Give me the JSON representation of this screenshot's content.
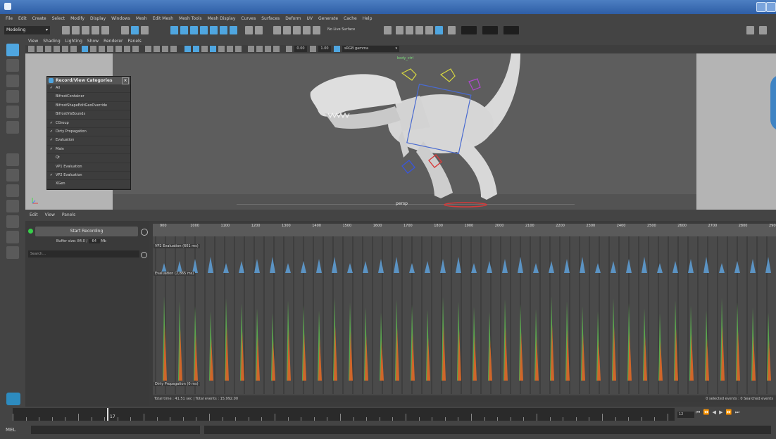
{
  "menus": [
    "File",
    "Edit",
    "Create",
    "Select",
    "Modify",
    "Display",
    "Windows",
    "Mesh",
    "Edit Mesh",
    "Mesh Tools",
    "Mesh Display",
    "Curves",
    "Surfaces",
    "Deform",
    "UV",
    "Generate",
    "Cache",
    "Help"
  ],
  "workspace_mode": "Modeling",
  "shelf": {
    "live_surface_label": "No Live Surface",
    "exposure_value": "0.00",
    "gamma_value": "1.00",
    "color_space": "sRGB gamma"
  },
  "panel_menu": [
    "View",
    "Shading",
    "Lighting",
    "Show",
    "Renderer",
    "Panels"
  ],
  "viewport": {
    "camera_label": "persp",
    "overlay_label": "body_ctrl"
  },
  "categories_popup": {
    "title": "Record/View Categories",
    "items": [
      {
        "label": "All",
        "checked": true
      },
      {
        "label": "BifrostContainer",
        "checked": false
      },
      {
        "label": "BifrostShapeEditGeoOverride",
        "checked": false
      },
      {
        "label": "BifrostVisBounds",
        "checked": false
      },
      {
        "label": "CGroup",
        "checked": true
      },
      {
        "label": "Dirty Propagation",
        "checked": true
      },
      {
        "label": "Evaluation",
        "checked": true
      },
      {
        "label": "Main",
        "checked": true
      },
      {
        "label": "Qt",
        "checked": false
      },
      {
        "label": "VP1 Evaluation",
        "checked": false
      },
      {
        "label": "VP2 Evaluation",
        "checked": true
      },
      {
        "label": "XGen",
        "checked": false
      }
    ]
  },
  "profiler": {
    "menu": [
      "Edit",
      "View",
      "Panels"
    ],
    "start_button": "Start Recording",
    "buffer_label": "Buffer size: 84.0 /",
    "buffer_value": "64",
    "buffer_unit": "Mb",
    "search_placeholder": "Search...",
    "tick_labels": [
      "900",
      "1000",
      "1100",
      "1200",
      "1300",
      "1400",
      "1500",
      "1600",
      "1700",
      "1800",
      "1900",
      "2000",
      "2100",
      "2200",
      "2300",
      "2400",
      "2500",
      "2600",
      "2700",
      "2800",
      "2900"
    ],
    "row_vp2": "VP2 Evaluation (601 ms)",
    "row_eval": "Evaluation (2,865 ms)",
    "row_dirty": "Dirty Propagation (0 ms)",
    "status_left": "Total time : 41.51 sec | Total events : 15,992.00",
    "status_right": "0 selected events : 0 Searched events"
  },
  "timeslider": {
    "current_frame": "17",
    "end_field": "12"
  },
  "commandline": {
    "label": "MEL"
  },
  "colors": {
    "accent": "#4fa6e0",
    "vp2_bar": "#5b93c3",
    "eval_green": "#5aa64e",
    "eval_orange": "#d0662a"
  }
}
